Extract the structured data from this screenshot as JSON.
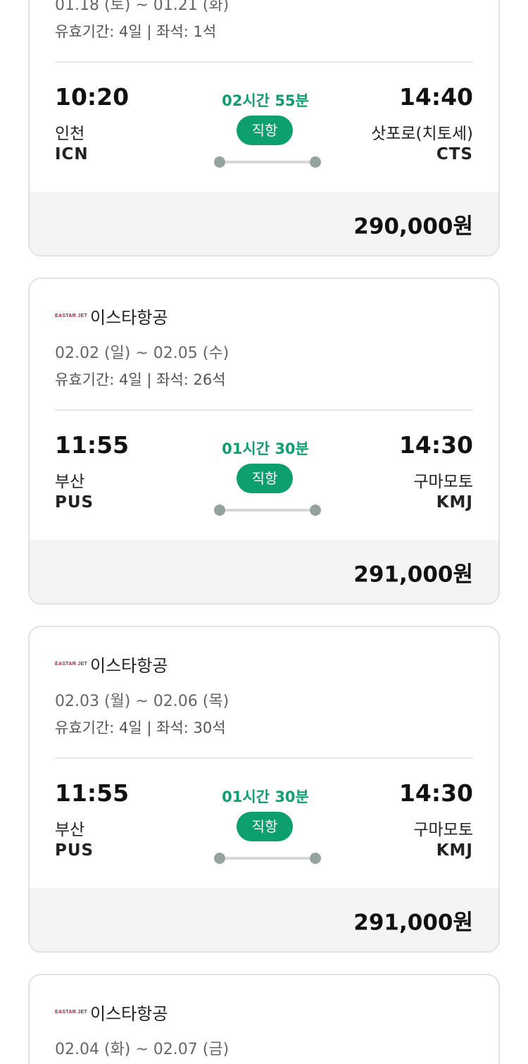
{
  "cards": [
    {
      "airline": {
        "logo_text": "",
        "name": ""
      },
      "dates": "01.18 (토) ~ 01.21 (화)",
      "validity": "유효기간: 4일 | 좌석: 1석",
      "departure": {
        "time": "10:20",
        "city": "인천",
        "code": "ICN"
      },
      "arrival": {
        "time": "14:40",
        "city": "삿포로(치토세)",
        "code": "CTS"
      },
      "duration": "02시간 55분",
      "flight_type": "직항",
      "price": "290,000원"
    },
    {
      "airline": {
        "logo_text": "EASTAR JET",
        "name": "이스타항공"
      },
      "dates": "02.02 (일) ~ 02.05 (수)",
      "validity": "유효기간: 4일 | 좌석: 26석",
      "departure": {
        "time": "11:55",
        "city": "부산",
        "code": "PUS"
      },
      "arrival": {
        "time": "14:30",
        "city": "구마모토",
        "code": "KMJ"
      },
      "duration": "01시간 30분",
      "flight_type": "직항",
      "price": "291,000원"
    },
    {
      "airline": {
        "logo_text": "EASTAR JET",
        "name": "이스타항공"
      },
      "dates": "02.03 (월) ~ 02.06 (목)",
      "validity": "유효기간: 4일 | 좌석: 30석",
      "departure": {
        "time": "11:55",
        "city": "부산",
        "code": "PUS"
      },
      "arrival": {
        "time": "14:30",
        "city": "구마모토",
        "code": "KMJ"
      },
      "duration": "01시간 30분",
      "flight_type": "직항",
      "price": "291,000원"
    },
    {
      "airline": {
        "logo_text": "EASTAR JET",
        "name": "이스타항공"
      },
      "dates": "02.04 (화) ~ 02.07 (금)"
    }
  ],
  "colors": {
    "accent_green": "#0e9f6e",
    "logo_red": "#c8102e",
    "price_bg": "#f4f4f4"
  }
}
